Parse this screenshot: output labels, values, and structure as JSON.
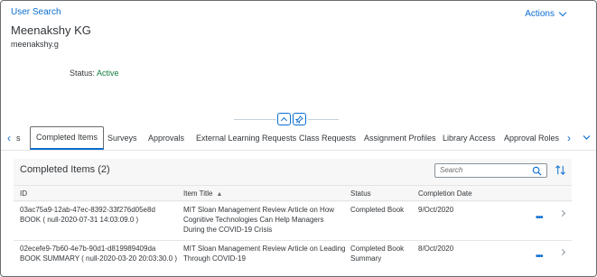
{
  "header": {
    "breadcrumb": "User Search",
    "actions_label": "Actions",
    "user_name": "Meenakshy KG",
    "user_id": "meenakshy.g",
    "status_label": "Status:",
    "status_value": "Active",
    "status_color": "#107e3e"
  },
  "tabs": [
    {
      "label": "s",
      "selected": false
    },
    {
      "label": "Completed Items",
      "selected": true
    },
    {
      "label": "Surveys",
      "selected": false
    },
    {
      "label": "Approvals",
      "selected": false
    },
    {
      "label": "External Learning Requests",
      "selected": false
    },
    {
      "label": "Class Requests",
      "selected": false
    },
    {
      "label": "Assignment Profiles",
      "selected": false
    },
    {
      "label": "Library Access",
      "selected": false
    },
    {
      "label": "Approval Roles",
      "selected": false
    }
  ],
  "panel": {
    "title": "Completed Items (2)",
    "search_placeholder": "Search",
    "columns": {
      "id": "ID",
      "item_title": "Item Title",
      "status": "Status",
      "completion_date": "Completion Date"
    },
    "rows": [
      {
        "id_line1": "03ac75a9-12ab-47ec-8392-33f276d05e8d",
        "id_line2": "BOOK ( null-2020-07-31 14:03:09.0 )",
        "title_line1": "MIT Sloan Management Review Article on How",
        "title_line2": "Cognitive Technologies Can Help Managers",
        "title_line3": "During the COVID-19 Crisis",
        "status_line1": "Completed Book",
        "status_line2": "",
        "date": "9/Oct/2020"
      },
      {
        "id_line1": "02ecefe9-7b60-4e7b-90d1-d819989409da",
        "id_line2": "BOOK SUMMARY ( null-2020-03-20 20:03:30.0 )",
        "title_line1": "MIT Sloan Management Review Article on Leading",
        "title_line2": "Through COVID-19",
        "title_line3": "",
        "status_line1": "Completed Book",
        "status_line2": "Summary",
        "date": "8/Oct/2020"
      }
    ]
  },
  "colors": {
    "accent": "#0a6ed1",
    "text": "#32363a"
  }
}
